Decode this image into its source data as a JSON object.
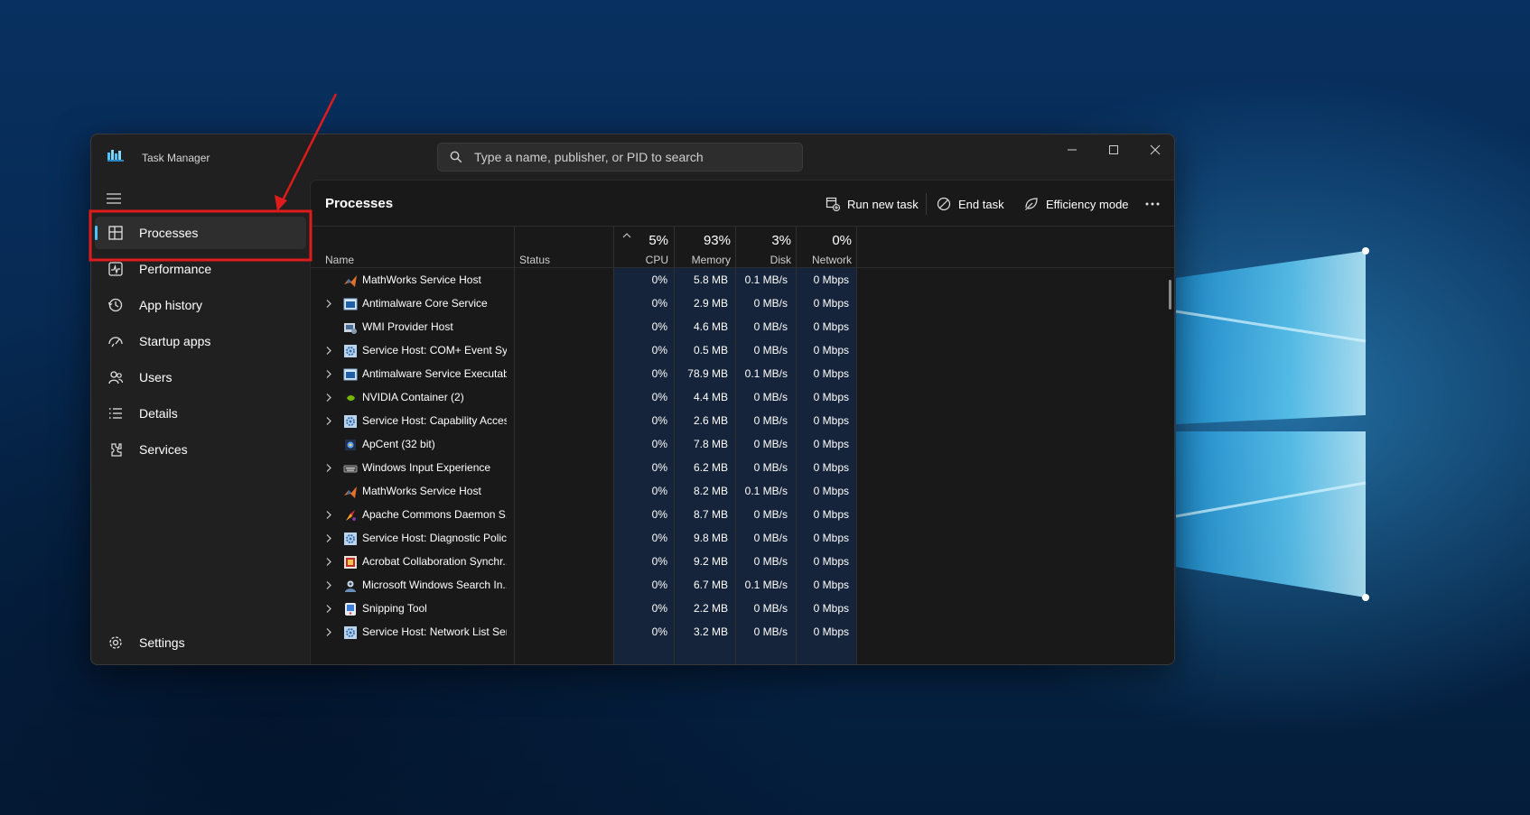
{
  "window": {
    "title": "Task Manager"
  },
  "search": {
    "placeholder": "Type a name, publisher, or PID to search"
  },
  "sidebar": {
    "items": [
      {
        "label": "Processes",
        "icon": "processes-icon",
        "active": true
      },
      {
        "label": "Performance",
        "icon": "performance-icon"
      },
      {
        "label": "App history",
        "icon": "app-history-icon"
      },
      {
        "label": "Startup apps",
        "icon": "startup-apps-icon"
      },
      {
        "label": "Users",
        "icon": "users-icon"
      },
      {
        "label": "Details",
        "icon": "details-icon"
      },
      {
        "label": "Services",
        "icon": "services-icon"
      }
    ],
    "settings_label": "Settings"
  },
  "main": {
    "title": "Processes",
    "toolbar": {
      "run_new_task": "Run new task",
      "end_task": "End task",
      "efficiency_mode": "Efficiency mode"
    }
  },
  "table": {
    "columns": {
      "name": "Name",
      "status": "Status",
      "cpu": {
        "pct": "5%",
        "label": "CPU"
      },
      "memory": {
        "pct": "93%",
        "label": "Memory"
      },
      "disk": {
        "pct": "3%",
        "label": "Disk"
      },
      "network": {
        "pct": "0%",
        "label": "Network"
      }
    },
    "rows": [
      {
        "name": "MathWorks Service Host",
        "expandable": false,
        "icon": "matlab-icon",
        "cpu": "0%",
        "memory": "5.8 MB",
        "disk": "0.1 MB/s",
        "network": "0 Mbps"
      },
      {
        "name": "Antimalware Core Service",
        "expandable": true,
        "icon": "window-app-icon",
        "cpu": "0%",
        "memory": "2.9 MB",
        "disk": "0 MB/s",
        "network": "0 Mbps"
      },
      {
        "name": "WMI Provider Host",
        "expandable": false,
        "icon": "wmi-icon",
        "cpu": "0%",
        "memory": "4.6 MB",
        "disk": "0 MB/s",
        "network": "0 Mbps"
      },
      {
        "name": "Service Host: COM+ Event Sys...",
        "expandable": true,
        "icon": "service-gear-icon",
        "cpu": "0%",
        "memory": "0.5 MB",
        "disk": "0 MB/s",
        "network": "0 Mbps"
      },
      {
        "name": "Antimalware Service Executable",
        "expandable": true,
        "icon": "window-app-icon",
        "cpu": "0%",
        "memory": "78.9 MB",
        "disk": "0.1 MB/s",
        "network": "0 Mbps"
      },
      {
        "name": "NVIDIA Container (2)",
        "expandable": true,
        "icon": "nvidia-icon",
        "cpu": "0%",
        "memory": "4.4 MB",
        "disk": "0 MB/s",
        "network": "0 Mbps"
      },
      {
        "name": "Service Host: Capability Acces...",
        "expandable": true,
        "icon": "service-gear-icon",
        "cpu": "0%",
        "memory": "2.6 MB",
        "disk": "0 MB/s",
        "network": "0 Mbps"
      },
      {
        "name": "ApCent (32 bit)",
        "expandable": false,
        "icon": "apcent-icon",
        "cpu": "0%",
        "memory": "7.8 MB",
        "disk": "0 MB/s",
        "network": "0 Mbps"
      },
      {
        "name": "Windows Input Experience",
        "expandable": true,
        "icon": "keyboard-icon",
        "cpu": "0%",
        "memory": "6.2 MB",
        "disk": "0 MB/s",
        "network": "0 Mbps"
      },
      {
        "name": "MathWorks Service Host",
        "expandable": false,
        "icon": "matlab-icon",
        "cpu": "0%",
        "memory": "8.2 MB",
        "disk": "0.1 MB/s",
        "network": "0 Mbps"
      },
      {
        "name": "Apache Commons Daemon S...",
        "expandable": true,
        "icon": "apache-icon",
        "cpu": "0%",
        "memory": "8.7 MB",
        "disk": "0 MB/s",
        "network": "0 Mbps"
      },
      {
        "name": "Service Host: Diagnostic Polic...",
        "expandable": true,
        "icon": "service-gear-icon",
        "cpu": "0%",
        "memory": "9.8 MB",
        "disk": "0 MB/s",
        "network": "0 Mbps"
      },
      {
        "name": "Acrobat Collaboration Synchr...",
        "expandable": true,
        "icon": "acrobat-icon",
        "cpu": "0%",
        "memory": "9.2 MB",
        "disk": "0 MB/s",
        "network": "0 Mbps"
      },
      {
        "name": "Microsoft Windows Search In...",
        "expandable": true,
        "icon": "search-indexer-icon",
        "cpu": "0%",
        "memory": "6.7 MB",
        "disk": "0.1 MB/s",
        "network": "0 Mbps"
      },
      {
        "name": "Snipping Tool",
        "expandable": true,
        "icon": "snipping-tool-icon",
        "cpu": "0%",
        "memory": "2.2 MB",
        "disk": "0 MB/s",
        "network": "0 Mbps"
      },
      {
        "name": "Service Host: Network List Ser...",
        "expandable": true,
        "icon": "service-gear-icon",
        "cpu": "0%",
        "memory": "3.2 MB",
        "disk": "0 MB/s",
        "network": "0 Mbps"
      }
    ]
  },
  "colors": {
    "accent": "#4cc2ff",
    "annotation": "#e01b1b",
    "usage_highlight": "#15243a"
  }
}
